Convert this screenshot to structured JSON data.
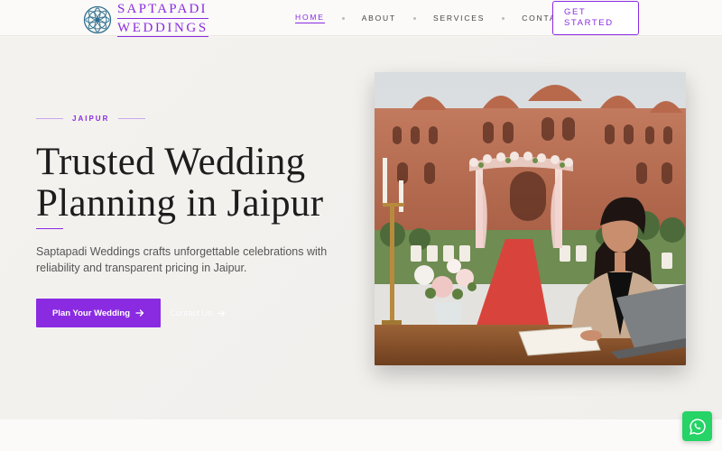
{
  "brand": {
    "line1": "SAPTAPADI",
    "line2": "WEDDINGS",
    "accent_color": "#8a2be2"
  },
  "nav": {
    "items": [
      {
        "label": "HOME",
        "active": true
      },
      {
        "label": "ABOUT",
        "active": false
      },
      {
        "label": "SERVICES",
        "active": false
      },
      {
        "label": "CONTACT",
        "active": false
      }
    ],
    "cta_label": "GET STARTED"
  },
  "hero": {
    "eyebrow": "JAIPUR",
    "headline_line1": "Trusted Wedding",
    "headline_line2": "Planning in Jaipur",
    "subtext": "Saptapadi Weddings crafts unforgettable celebrations with reliability and transparent pricing in Jaipur.",
    "primary_button": "Plan Your Wedding",
    "secondary_link": "Contact Us"
  },
  "icons": {
    "logo": "mandala-logo-icon",
    "arrow": "arrow-right-icon",
    "whatsapp": "whatsapp-icon"
  },
  "whatsapp_color": "#25d366"
}
